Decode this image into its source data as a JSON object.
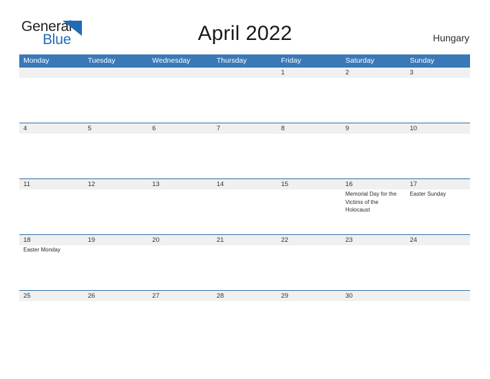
{
  "brand": {
    "name_part1": "General",
    "name_part2": "Blue",
    "accent_color": "#1f6cb5",
    "triangle_icon": "brand-triangle-icon"
  },
  "header": {
    "title": "April 2022",
    "country": "Hungary"
  },
  "theme": {
    "header_bar_color": "#3a79b8",
    "date_band_color": "#f0f0f0",
    "rule_color": "#2e6da4",
    "text_color": "#333333"
  },
  "calendar": {
    "month": "April",
    "year": "2022",
    "weekday_headers": [
      "Monday",
      "Tuesday",
      "Wednesday",
      "Thursday",
      "Friday",
      "Saturday",
      "Sunday"
    ],
    "weeks": [
      [
        {
          "date": "",
          "events": []
        },
        {
          "date": "",
          "events": []
        },
        {
          "date": "",
          "events": []
        },
        {
          "date": "",
          "events": []
        },
        {
          "date": "1",
          "events": []
        },
        {
          "date": "2",
          "events": []
        },
        {
          "date": "3",
          "events": []
        }
      ],
      [
        {
          "date": "4",
          "events": []
        },
        {
          "date": "5",
          "events": []
        },
        {
          "date": "6",
          "events": []
        },
        {
          "date": "7",
          "events": []
        },
        {
          "date": "8",
          "events": []
        },
        {
          "date": "9",
          "events": []
        },
        {
          "date": "10",
          "events": []
        }
      ],
      [
        {
          "date": "11",
          "events": []
        },
        {
          "date": "12",
          "events": []
        },
        {
          "date": "13",
          "events": []
        },
        {
          "date": "14",
          "events": []
        },
        {
          "date": "15",
          "events": []
        },
        {
          "date": "16",
          "events": [
            "Memorial Day for the Victims of the Holocaust"
          ]
        },
        {
          "date": "17",
          "events": [
            "Easter Sunday"
          ]
        }
      ],
      [
        {
          "date": "18",
          "events": [
            "Easter Monday"
          ]
        },
        {
          "date": "19",
          "events": []
        },
        {
          "date": "20",
          "events": []
        },
        {
          "date": "21",
          "events": []
        },
        {
          "date": "22",
          "events": []
        },
        {
          "date": "23",
          "events": []
        },
        {
          "date": "24",
          "events": []
        }
      ],
      [
        {
          "date": "25",
          "events": []
        },
        {
          "date": "26",
          "events": []
        },
        {
          "date": "27",
          "events": []
        },
        {
          "date": "28",
          "events": []
        },
        {
          "date": "29",
          "events": []
        },
        {
          "date": "30",
          "events": []
        },
        {
          "date": "",
          "events": []
        }
      ]
    ]
  }
}
